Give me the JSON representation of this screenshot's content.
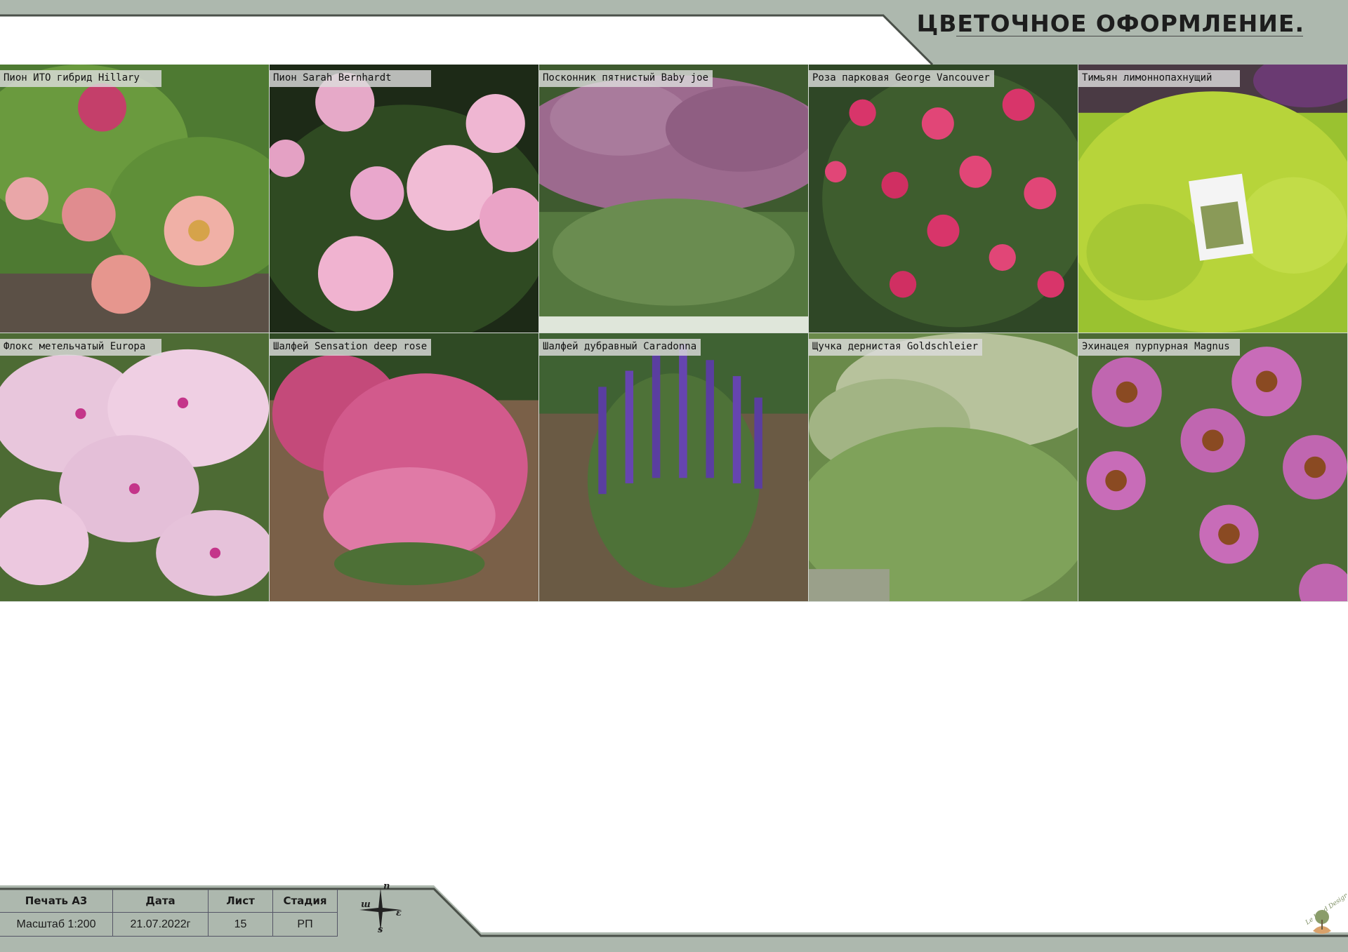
{
  "header": {
    "title": "ЦВЕТОЧНОЕ ОФОРМЛЕНИЕ."
  },
  "gallery": [
    {
      "label": "Пион ИТО гибрид Hillary"
    },
    {
      "label": "Пион Sarah Bernhardt"
    },
    {
      "label": "Посконник пятнистый Baby joe"
    },
    {
      "label": "Роза парковая George Vancouver"
    },
    {
      "label": "Тимьян лимоннопахнущий"
    },
    {
      "label": "Флокс метельчатый Europa"
    },
    {
      "label": "Шалфей Sensation deep rose"
    },
    {
      "label": "Шалфей дубравный Caradonna"
    },
    {
      "label": "Щучка дернистая Goldschleier"
    },
    {
      "label": "Эхинацея пурпурная Magnus"
    }
  ],
  "title_block": {
    "print_label": "Печать А3",
    "date_label": "Дата",
    "sheet_label": "Лист",
    "stage_label": "Стадия",
    "scale_value": "Масштаб 1:200",
    "date_value": "21.07.2022г",
    "sheet_value": "15",
    "stage_value": "РП"
  },
  "compass": {
    "n": "n",
    "s": "s",
    "w": "ш",
    "e": "ε"
  },
  "colors": {
    "band": "#adb8ae",
    "band_line": "#4a5049",
    "label_bg": "#dcdcdc"
  },
  "logo": {
    "text": "Le Land Design"
  }
}
